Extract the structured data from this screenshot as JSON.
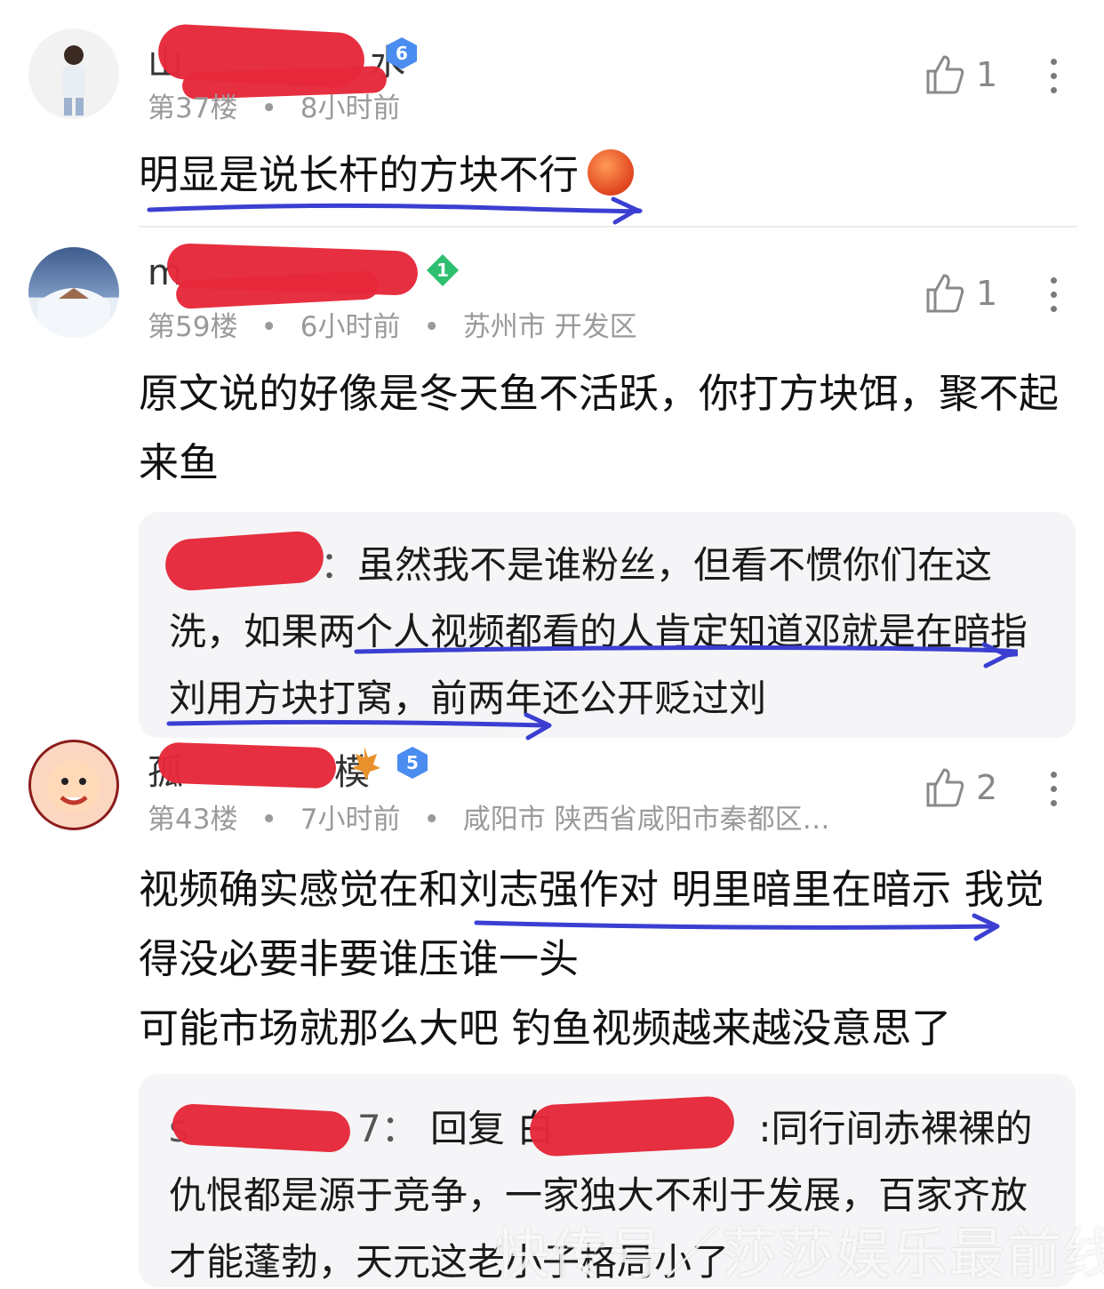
{
  "comments": [
    {
      "name_visible_start": "山",
      "name_visible_end": "水",
      "level": "6",
      "floor": "第37楼",
      "time": "8小时前",
      "location": "",
      "likes": "1",
      "text": "明显是说长杆的方块不行"
    },
    {
      "name_visible_start": "m",
      "name_visible_end": "",
      "level": "1",
      "floor": "第59楼",
      "time": "6小时前",
      "location": "苏州市 开发区",
      "likes": "1",
      "text": "原文说的好像是冬天鱼不活跃，你打方块饵，聚不起来鱼",
      "reply": {
        "name_suffix": "：",
        "text": "虽然我不是谁粉丝，但看不惯你们在这洗，如果两个人视频都看的人肯定知道邓就是在暗指刘用方块打窝，前两年还公开贬过刘"
      }
    },
    {
      "name_visible_start": "孤",
      "name_visible_end": "模",
      "level": "5",
      "floor": "第43楼",
      "time": "7小时前",
      "location": "咸阳市 陕西省咸阳市秦都区…",
      "likes": "2",
      "text": "视频确实感觉在和刘志强作对 明里暗里在暗示 我觉得没必要非要谁压谁一头\n可能市场就那么大吧 钓鱼视频越来越没意思了",
      "reply": {
        "name_prefix": "s",
        "name_suffix": "7：",
        "reply_label": "回复",
        "target_prefix": "白",
        "text": ":同行间赤裸裸的仇恨都是源于竞争，一家独大不利于发展，百家齐放才能蓬勃，天元这老小子格局小了"
      }
    }
  ],
  "watermark": "快传号／莎莎娱乐最前线",
  "colors": {
    "redaction": "#e5283a",
    "underline": "#3b3fd1",
    "badge_blue": "#4a8cf0",
    "badge_green": "#2fbf71"
  }
}
